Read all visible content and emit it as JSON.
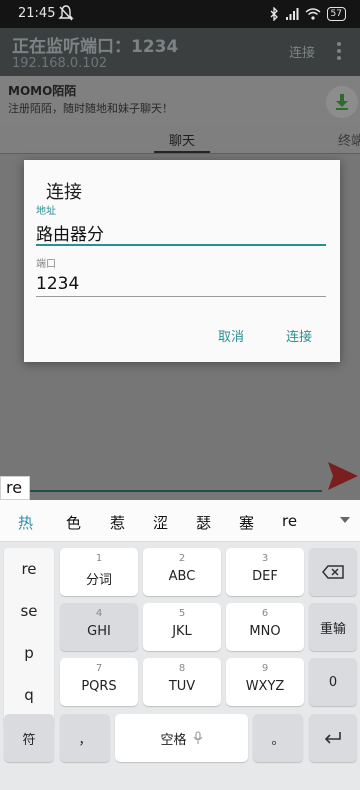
{
  "status_bar": {
    "time": "21:45",
    "battery": "57"
  },
  "app_bar": {
    "title": "正在监听端口：1234",
    "subtitle": "192.168.0.102",
    "connect_label": "连接"
  },
  "ad": {
    "title": "MOMO陌陌",
    "text": "注册陌陌，随时随地和妹子聊天！"
  },
  "tabs": {
    "chat": "聊天",
    "terminal": "终端"
  },
  "dialog": {
    "title": "连接",
    "address_label": "地址",
    "address_value": "路由器分",
    "port_label": "端口",
    "port_value": "1234",
    "cancel": "取消",
    "ok": "连接"
  },
  "composing": "re",
  "keyboard": {
    "candidates": [
      "热",
      "色",
      "惹",
      "涩",
      "瑟",
      "塞",
      "re"
    ],
    "pinyin": [
      "re",
      "se",
      "p",
      "q"
    ],
    "keys": {
      "k1": {
        "num": "1",
        "label": "分词"
      },
      "k2": {
        "num": "2",
        "label": "ABC"
      },
      "k3": {
        "num": "3",
        "label": "DEF"
      },
      "k4": {
        "num": "4",
        "label": "GHI"
      },
      "k5": {
        "num": "5",
        "label": "JKL"
      },
      "k6": {
        "num": "6",
        "label": "MNO"
      },
      "k7": {
        "num": "7",
        "label": "PQRS"
      },
      "k8": {
        "num": "8",
        "label": "TUV"
      },
      "k9": {
        "num": "9",
        "label": "WXYZ"
      }
    },
    "reenter": "重输",
    "zero": "0",
    "symbol": "符",
    "comma": "，",
    "space": "空格",
    "period": "。"
  }
}
